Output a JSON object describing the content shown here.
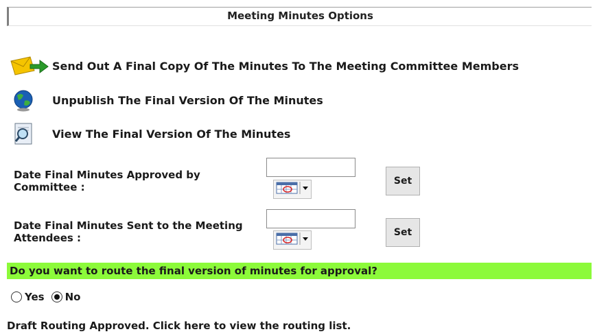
{
  "header": {
    "title": "Meeting Minutes Options"
  },
  "options": [
    {
      "label": "Send Out A Final Copy Of The Minutes To The Meeting Committee Members",
      "icon": "envelope-arrow-icon"
    },
    {
      "label": "Unpublish The Final Version Of The Minutes",
      "icon": "globe-icon"
    },
    {
      "label": "View The Final Version Of The Minutes",
      "icon": "magnifier-document-icon"
    }
  ],
  "dates": [
    {
      "label": "Date Final Minutes Approved by Committee :",
      "value": "",
      "set_label": "Set",
      "calendar_icon": "calendar-dropdown-icon"
    },
    {
      "label": "Date Final Minutes Sent to the Meeting Attendees :",
      "value": "",
      "set_label": "Set",
      "calendar_icon": "calendar-dropdown-icon"
    }
  ],
  "routing": {
    "question": "Do you want to route the final version of minutes for approval?",
    "highlight_color": "#8cfa3a",
    "yes_label": "Yes",
    "no_label": "No",
    "selected": "No",
    "link_text": "Draft Routing Approved. Click here to view the routing list."
  }
}
